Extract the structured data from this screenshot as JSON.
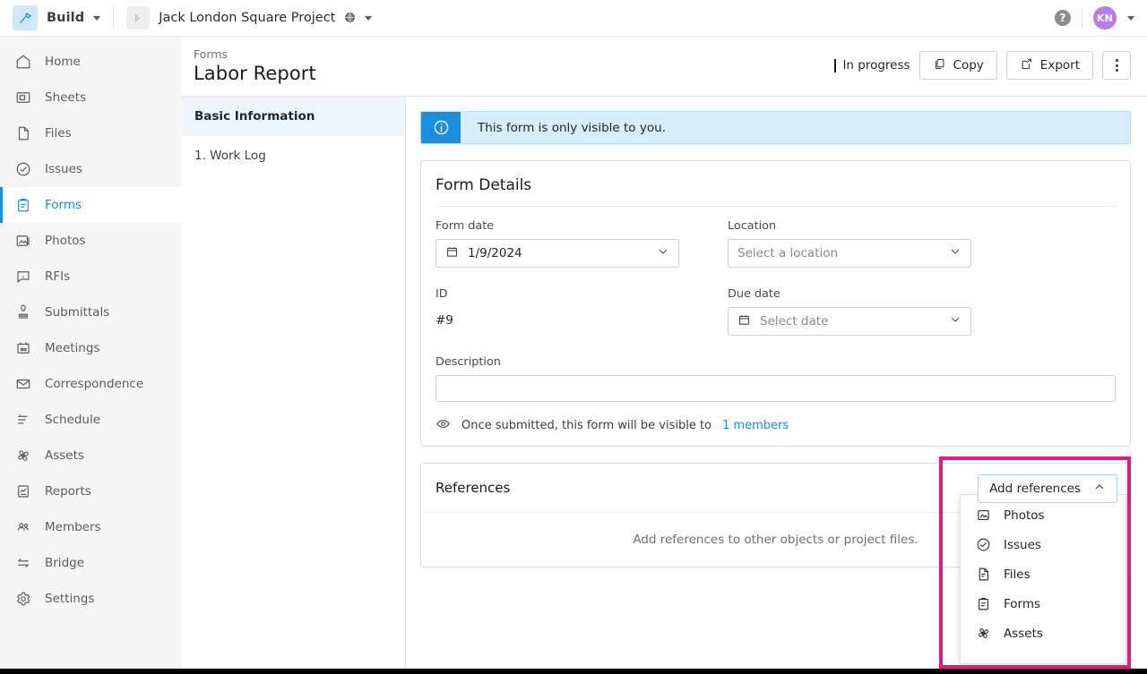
{
  "topbar": {
    "brand_label": "Build",
    "brand_logo_icon": "hammer-icon",
    "brand_caret_icon": "chevron-down-icon",
    "project_name": "Jack London Square Project",
    "project_thumb_icon": "project-thumbnail-icon",
    "project_globe_icon": "globe-icon",
    "project_caret_icon": "chevron-down-icon",
    "help_label": "?",
    "help_icon": "help-circle-icon",
    "avatar_initials": "KN",
    "avatar_caret_icon": "chevron-down-icon"
  },
  "sidebar": {
    "items": [
      {
        "label": "Home",
        "icon": "home-icon",
        "active": false
      },
      {
        "label": "Sheets",
        "icon": "sheets-icon",
        "active": false
      },
      {
        "label": "Files",
        "icon": "file-icon",
        "active": false
      },
      {
        "label": "Issues",
        "icon": "check-circle-icon",
        "active": false
      },
      {
        "label": "Forms",
        "icon": "clipboard-icon",
        "active": true
      },
      {
        "label": "Photos",
        "icon": "photo-icon",
        "active": false
      },
      {
        "label": "RFIs",
        "icon": "rfi-speech-icon",
        "active": false
      },
      {
        "label": "Submittals",
        "icon": "stamp-icon",
        "active": false
      },
      {
        "label": "Meetings",
        "icon": "meetings-calendar-icon",
        "active": false
      },
      {
        "label": "Correspondence",
        "icon": "envelope-icon",
        "active": false
      },
      {
        "label": "Schedule",
        "icon": "schedule-icon",
        "active": false
      },
      {
        "label": "Assets",
        "icon": "assets-fan-icon",
        "active": false
      },
      {
        "label": "Reports",
        "icon": "report-chart-icon",
        "active": false
      },
      {
        "label": "Members",
        "icon": "members-people-icon",
        "active": false
      },
      {
        "label": "Bridge",
        "icon": "bridge-arrows-icon",
        "active": false
      },
      {
        "label": "Settings",
        "icon": "gear-icon",
        "active": false
      }
    ]
  },
  "subnav": {
    "items": [
      {
        "label": "Basic Information",
        "selected": true
      },
      {
        "label": "1. Work Log",
        "selected": false
      }
    ]
  },
  "pagehead": {
    "breadcrumb": "Forms",
    "title": "Labor Report",
    "status": "In progress",
    "copy_label": "Copy",
    "copy_icon": "copy-icon",
    "export_label": "Export",
    "export_icon": "export-share-icon",
    "more_icon": "kebab-menu-icon"
  },
  "banner": {
    "icon": "info-circle-icon",
    "text": "This form is only visible to you."
  },
  "form_details": {
    "title": "Form Details",
    "form_date_label": "Form date",
    "form_date_value": "1/9/2024",
    "form_date_icon": "calendar-icon",
    "location_label": "Location",
    "location_placeholder": "Select a location",
    "id_label": "ID",
    "id_value": "#9",
    "due_date_label": "Due date",
    "due_date_placeholder": "Select date",
    "due_date_icon": "calendar-icon",
    "description_label": "Description",
    "description_value": "",
    "description_placeholder": "",
    "visibility_icon": "eye-icon",
    "visibility_text": "Once submitted, this form will be visible to",
    "visibility_link": "1 members"
  },
  "references": {
    "title": "References",
    "empty_text": "Add references to other objects or project files.",
    "add_button_label": "Add references",
    "add_button_caret_icon": "chevron-up-icon",
    "menu_items": [
      {
        "label": "Photos",
        "icon": "photo-icon"
      },
      {
        "label": "Issues",
        "icon": "check-circle-icon"
      },
      {
        "label": "Files",
        "icon": "file-lines-icon"
      },
      {
        "label": "Forms",
        "icon": "clipboard-icon"
      },
      {
        "label": "Assets",
        "icon": "assets-fan-icon"
      }
    ]
  },
  "colors": {
    "accent_blue": "#1b8ee0",
    "banner_bg": "#d7edfa",
    "highlight_pink": "#e01b84",
    "avatar_purple": "#b57eea",
    "sidebar_bg": "#f5f5f5"
  }
}
